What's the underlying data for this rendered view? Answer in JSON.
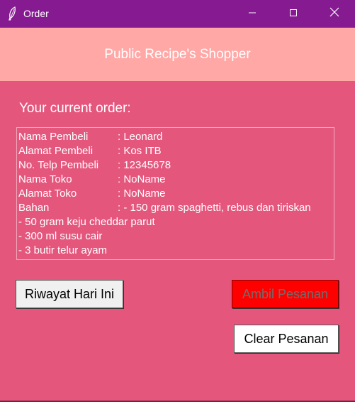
{
  "window": {
    "title": "Order",
    "app_icon": "feather-icon",
    "controls": [
      "minimize-icon",
      "maximize-icon",
      "close-icon"
    ],
    "titlebar_color": "#861b91"
  },
  "header": {
    "brand": "Public Recipe's Shopper",
    "band_color": "#ffa8a6"
  },
  "main": {
    "background": "#e5567d",
    "order_label": "Your current order:",
    "order_rows": [
      {
        "key": "Nama Pembeli",
        "value": ": Leonard"
      },
      {
        "key": "Alamat Pembeli",
        "value": ": Kos ITB"
      },
      {
        "key": "No. Telp Pembeli",
        "value": ": 12345678"
      },
      {
        "key": "Nama Toko",
        "value": ": NoName"
      },
      {
        "key": "Alamat Toko",
        "value": ": NoName"
      },
      {
        "key": "Bahan",
        "value": ": - 150 gram spaghetti, rebus dan tiriskan"
      }
    ],
    "order_extra_lines": [
      "- 50 gram keju cheddar parut",
      "- 300 ml susu cair",
      "- 3 butir telur ayam"
    ]
  },
  "buttons": {
    "riwayat": "Riwayat Hari Ini",
    "ambil": "Ambil Pesanan",
    "clear": "Clear Pesanan",
    "ambil_color": "#ff0000"
  }
}
